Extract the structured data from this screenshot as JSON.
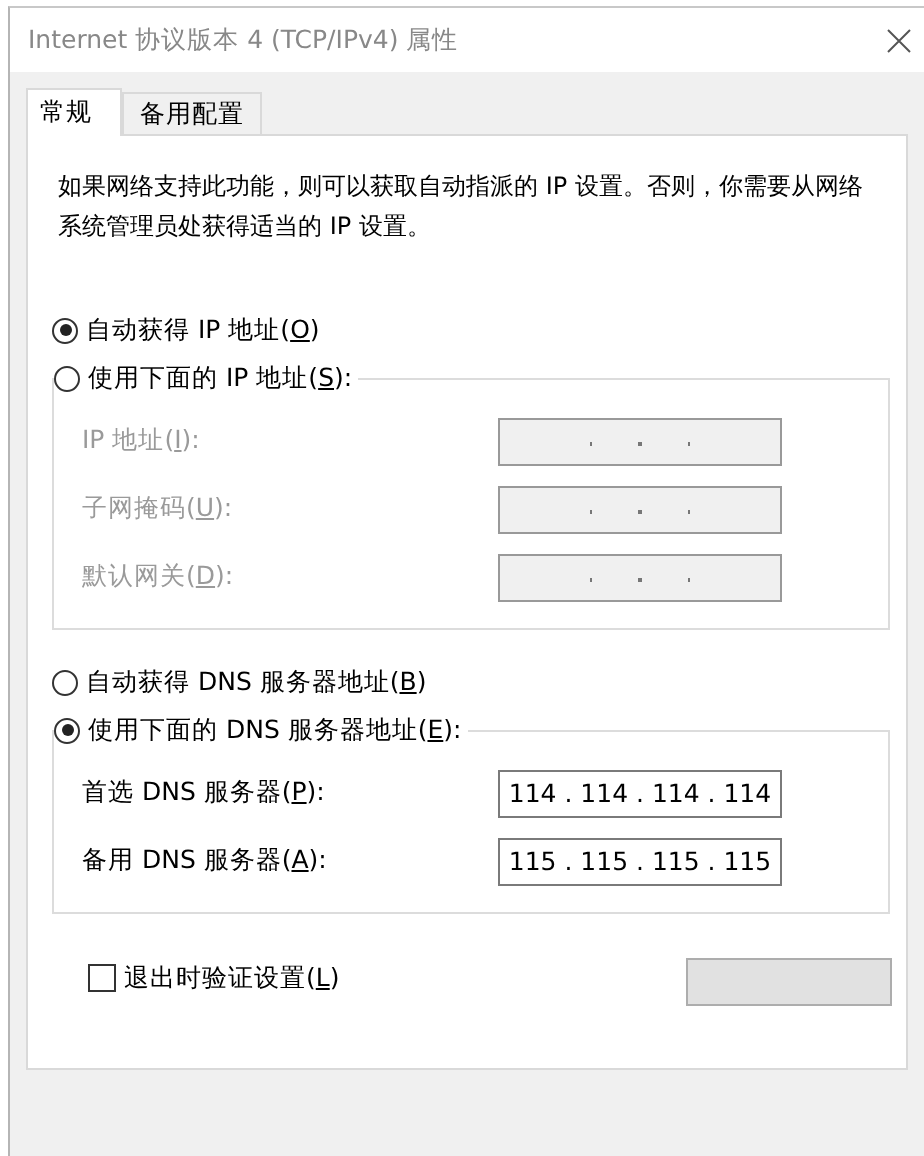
{
  "window": {
    "title": "Internet 协议版本 4 (TCP/IPv4) 属性"
  },
  "tabs": [
    {
      "label": "常规",
      "selected": true
    },
    {
      "label": "备用配置",
      "selected": false
    }
  ],
  "description": "如果网络支持此功能，则可以获取自动指派的 IP 设置。否则，你需要从网络系统管理员处获得适当的 IP 设置。",
  "ip_settings": {
    "auto_option": {
      "label": "自动获得 IP 地址(O)",
      "selected": true
    },
    "manual_option": {
      "label": "使用下面的 IP 地址(S):",
      "selected": false
    },
    "disabled": true,
    "fields": [
      {
        "label": "IP 地址(I):"
      },
      {
        "label": "子网掩码(U):"
      },
      {
        "label": "默认网关(D):"
      }
    ]
  },
  "dns_settings": {
    "auto_option": {
      "label": "自动获得 DNS 服务器地址(B)",
      "selected": false
    },
    "manual_option": {
      "label": "使用下面的 DNS 服务器地址(E):",
      "selected": true
    },
    "disabled": false,
    "fields": [
      {
        "label": "首选 DNS 服务器(P):",
        "value": "114 . 114 . 114 . 114"
      },
      {
        "label": "备用 DNS 服务器(A):",
        "value": "115 . 115 . 115 . 115"
      }
    ]
  },
  "validate_checkbox": {
    "label": "退出时验证设置(L)",
    "checked": false
  }
}
